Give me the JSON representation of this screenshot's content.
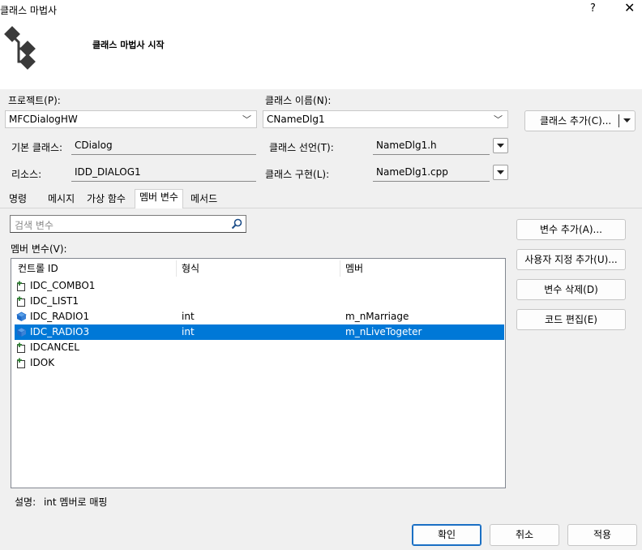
{
  "window": {
    "title": "클래스 마법사",
    "help": "?",
    "close": "✕"
  },
  "banner": {
    "title": "클래스 마법사 시작"
  },
  "project": {
    "label": "프로젝트(P):",
    "value": "MFCDialogHW"
  },
  "class_name": {
    "label": "클래스 이름(N):",
    "value": "CNameDlg1"
  },
  "add_class_button": {
    "label": "클래스 추가(C)..."
  },
  "base_class": {
    "label": "기본 클래스:",
    "value": "CDialog"
  },
  "class_declaration": {
    "label": "클래스 선언(T):",
    "value": "NameDlg1.h"
  },
  "resource": {
    "label": "리소스:",
    "value": "IDD_DIALOG1"
  },
  "class_implementation": {
    "label": "클래스 구현(L):",
    "value": "NameDlg1.cpp"
  },
  "tabs": [
    {
      "label": "명령"
    },
    {
      "label": "메시지"
    },
    {
      "label": "가상 함수"
    },
    {
      "label": "멤버 변수"
    },
    {
      "label": "메서드"
    }
  ],
  "search": {
    "placeholder": "검색 변수"
  },
  "member_variables_label": "멤버 변수(V):",
  "table": {
    "columns": [
      "컨트롤 ID",
      "형식",
      "멤버"
    ],
    "rows": [
      {
        "id": "IDC_COMBO1",
        "type": "",
        "member": "",
        "icon": "add-control-icon",
        "selected": false
      },
      {
        "id": "IDC_LIST1",
        "type": "",
        "member": "",
        "icon": "add-control-icon",
        "selected": false
      },
      {
        "id": "IDC_RADIO1",
        "type": "int",
        "member": "m_nMarriage",
        "icon": "variable-icon",
        "selected": false
      },
      {
        "id": "IDC_RADIO3",
        "type": "int",
        "member": "m_nLiveTogeter",
        "icon": "variable-icon",
        "selected": true
      },
      {
        "id": "IDCANCEL",
        "type": "",
        "member": "",
        "icon": "add-control-icon",
        "selected": false
      },
      {
        "id": "IDOK",
        "type": "",
        "member": "",
        "icon": "add-control-icon",
        "selected": false
      }
    ]
  },
  "side_buttons": {
    "add_variable": "변수 추가(A)...",
    "add_custom": "사용자 지정 추가(U)...",
    "delete_variable": "변수 삭제(D)",
    "edit_code": "코드 편집(E)"
  },
  "description": {
    "label": "설명:",
    "value": "int 멤버로 매핑"
  },
  "footer": {
    "ok": "확인",
    "cancel": "취소",
    "apply": "적용"
  },
  "colors": {
    "selection": "#0078d7",
    "accent": "#1a6fc4",
    "icon_green": "#2e7d32",
    "icon_blue": "#1e6ac8"
  }
}
